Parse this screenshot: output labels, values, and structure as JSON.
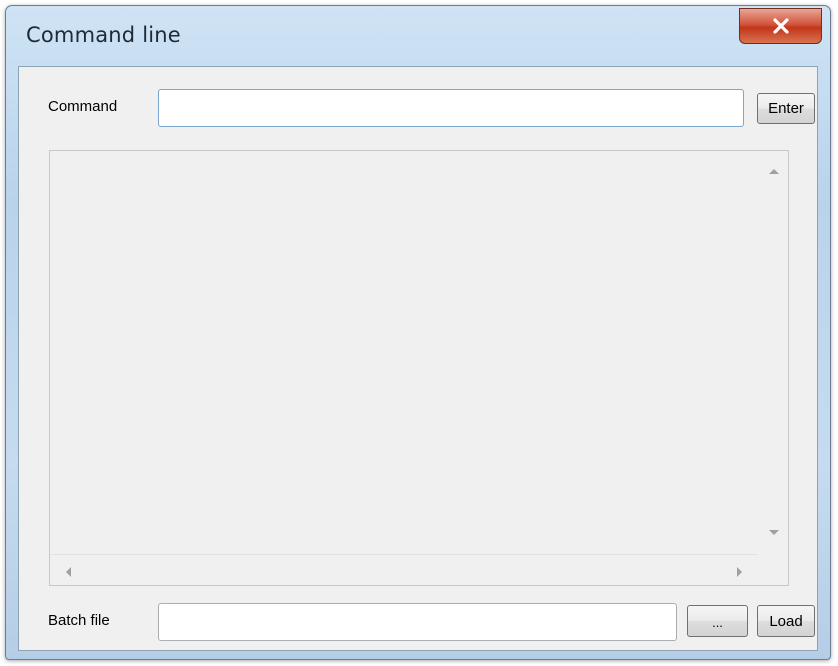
{
  "window": {
    "title": "Command line",
    "close_label": "X"
  },
  "command": {
    "label": "Command",
    "value": "",
    "placeholder": "",
    "enter_label": "Enter"
  },
  "output": {
    "text": ""
  },
  "batch": {
    "label": "Batch file",
    "value": "",
    "placeholder": "",
    "browse_label": "...",
    "load_label": "Load"
  },
  "icons": {
    "close": "close-icon",
    "up": "arrow-up-icon",
    "down": "arrow-down-icon",
    "left": "arrow-left-icon",
    "right": "arrow-right-icon"
  },
  "colors": {
    "title_bar": "#c6dbef",
    "close_button": "#c2361a",
    "client_bg": "#f0f0f0",
    "input_focus_border": "#7aa6d0"
  }
}
